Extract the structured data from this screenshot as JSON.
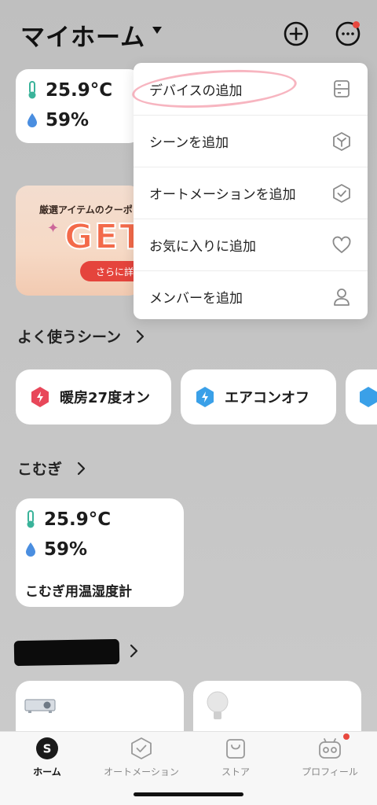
{
  "header": {
    "title": "マイホーム"
  },
  "weather": {
    "temperature": "25.9°C",
    "humidity": "59%"
  },
  "banner": {
    "title": "厳選アイテムのクーポ",
    "get_text": "GET",
    "button": "さらに詳し"
  },
  "menu": {
    "items": [
      {
        "label": "デバイスの追加",
        "icon": "device-list-icon"
      },
      {
        "label": "シーンを追加",
        "icon": "scene-cube-icon"
      },
      {
        "label": "オートメーションを追加",
        "icon": "automation-check-icon"
      },
      {
        "label": "お気に入りに追加",
        "icon": "heart-icon"
      },
      {
        "label": "メンバーを追加",
        "icon": "member-person-icon"
      }
    ]
  },
  "frequent_scenes": {
    "heading": "よく使うシーン",
    "items": [
      {
        "label": "暖房27度オン",
        "color": "#e8475a"
      },
      {
        "label": "エアコンオフ",
        "color": "#3aa0e8"
      }
    ]
  },
  "room": {
    "heading": "こむぎ"
  },
  "device": {
    "temperature": "25.9°C",
    "humidity": "59%",
    "name": "こむぎ用温湿度計"
  },
  "tabs": [
    {
      "label": "ホーム",
      "icon": "home-s-icon",
      "active": true
    },
    {
      "label": "オートメーション",
      "icon": "automation-icon",
      "active": false
    },
    {
      "label": "ストア",
      "icon": "store-bag-icon",
      "active": false
    },
    {
      "label": "プロフィール",
      "icon": "robot-profile-icon",
      "active": false
    }
  ],
  "colors": {
    "accent_red": "#e8483e",
    "thermo_green": "#3ab39a",
    "drop_blue": "#4a8ee0"
  }
}
